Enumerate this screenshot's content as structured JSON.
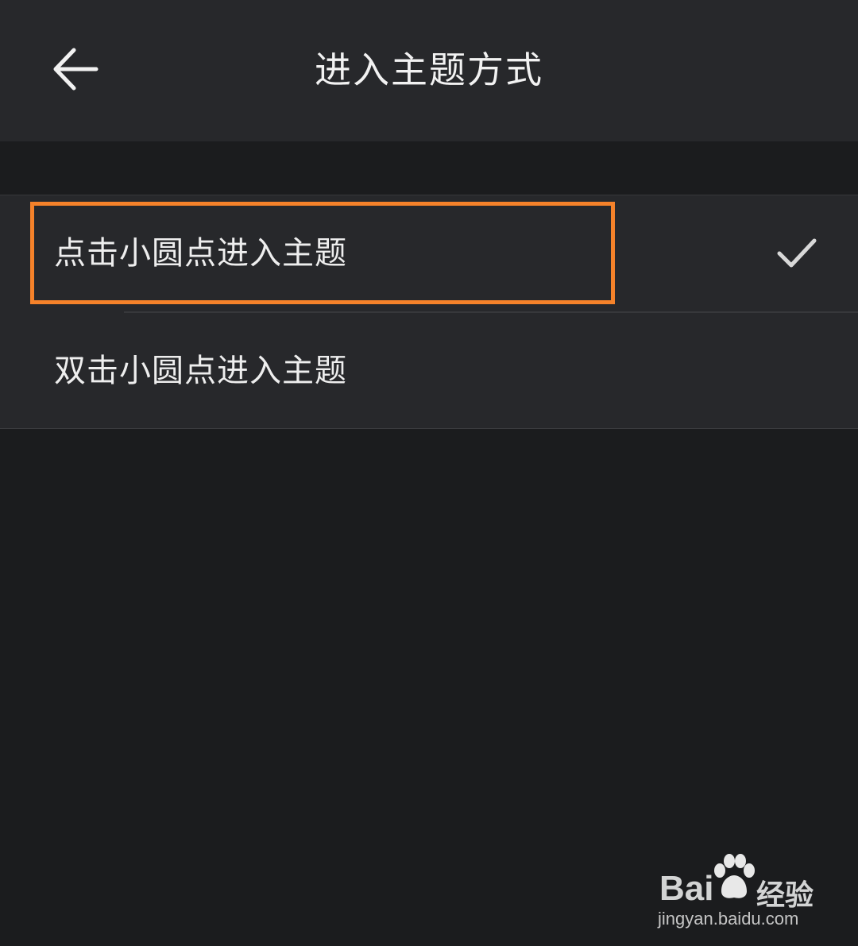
{
  "header": {
    "title": "进入主题方式",
    "back_icon": "arrow-left-icon"
  },
  "options": [
    {
      "label": "点击小圆点进入主题",
      "selected": true
    },
    {
      "label": "双击小圆点进入主题",
      "selected": false
    }
  ],
  "highlight_color": "#f5822a",
  "watermark": {
    "brand": "Bai",
    "suffix": "经验",
    "url": "jingyan.baidu.com"
  }
}
